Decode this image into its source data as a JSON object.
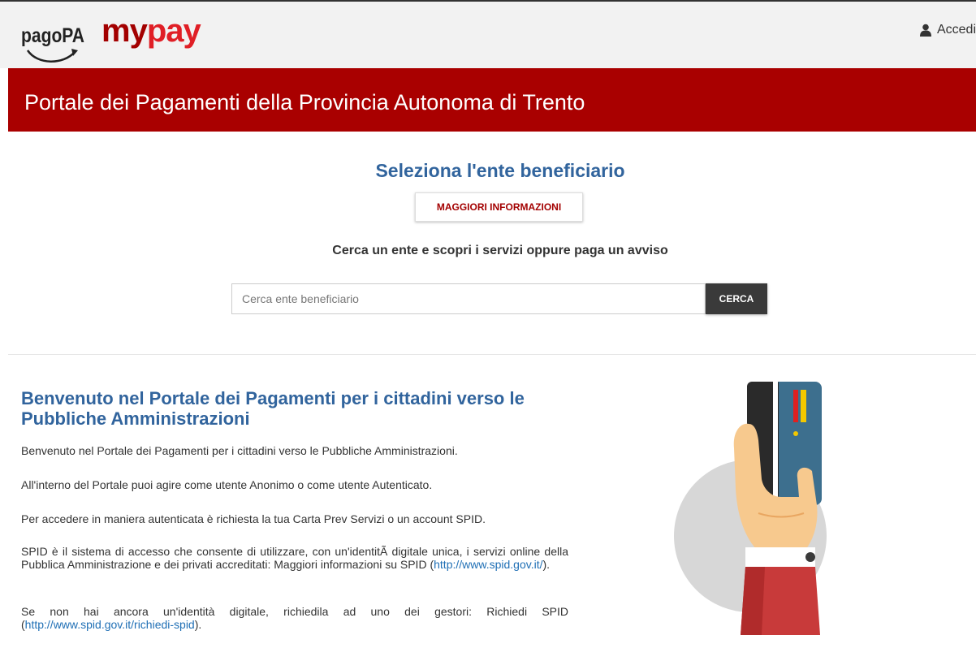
{
  "header": {
    "logo_pagopa": "pagoPA",
    "logo_mypay_my": "my",
    "logo_mypay_pay": "pay",
    "login_label": "Accedi",
    "login_icon": "user-icon"
  },
  "banner": {
    "title": "Portale dei Pagamenti della Provincia Autonoma di Trento",
    "color": "#a90000"
  },
  "search": {
    "heading": "Seleziona l'ente beneficiario",
    "info_button": "MAGGIORI INFORMAZIONI",
    "subheading": "Cerca un ente e scopri i servizi oppure paga un avviso",
    "placeholder": "Cerca ente beneficiario",
    "button": "CERCA"
  },
  "welcome": {
    "title": "Benvenuto nel Portale dei Pagamenti per i cittadini verso le Pubbliche Amministrazioni",
    "p1": "Benvenuto nel Portale dei Pagamenti per i cittadini verso le Pubbliche Amministrazioni.",
    "p2": "All'interno del Portale puoi agire come utente Anonimo o come utente Autenticato.",
    "p3": "Per accedere in maniera autenticata è richiesta la tua Carta Prev Servizi o un account SPID.",
    "p4_text": "SPID è il sistema di accesso che consente di utilizzare, con un'identitÃ  digitale unica, i servizi online della Pubblica Amministrazione e dei privati accreditati: Maggiori informazioni su SPID",
    "p4_link": "http://www.spid.gov.it/",
    "p5_text": "Se non hai ancora un'identità digitale, richiedila ad uno dei gestori: Richiedi SPID",
    "p5_link": "http://www.spid.gov.it/richiedi-spid",
    "illustration_icon": "hand-holding-card-icon"
  },
  "colors": {
    "accent_blue": "#31649d",
    "brand_red": "#a90000",
    "link": "#1f6fb5"
  }
}
